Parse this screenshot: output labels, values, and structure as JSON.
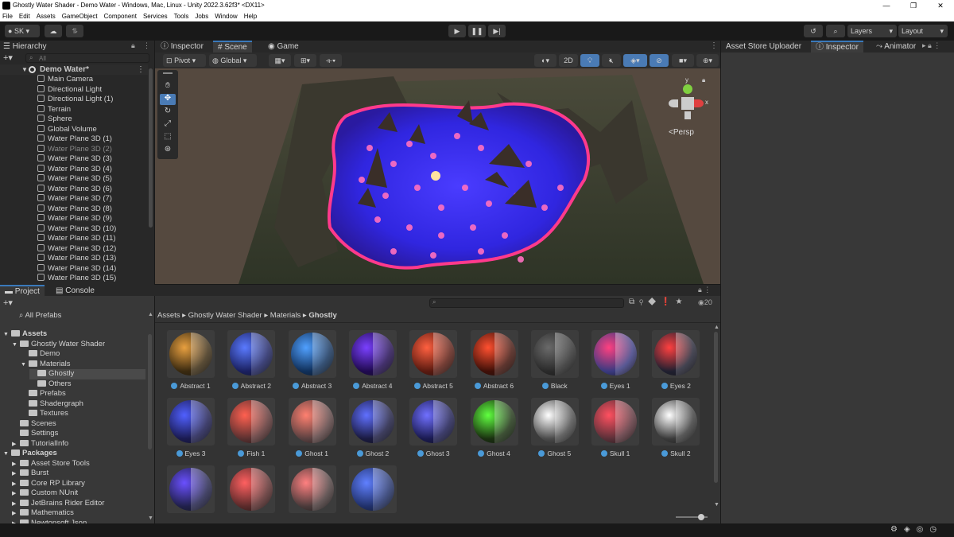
{
  "window": {
    "title": "Ghostly Water Shader - Demo Water - Windows, Mac, Linux - Unity 2022.3.62f3* <DX11>",
    "controls": [
      "—",
      "❐",
      "✕"
    ]
  },
  "menu": [
    "File",
    "Edit",
    "Assets",
    "GameObject",
    "Component",
    "Services",
    "Tools",
    "Jobs",
    "Window",
    "Help"
  ],
  "toolbar": {
    "account": "SK",
    "layers": "Layers",
    "layout": "Layout"
  },
  "hierarchy": {
    "tab": "Hierarchy",
    "search_placeholder": "All",
    "scene": "Demo Water*",
    "items": [
      {
        "label": "Main Camera",
        "dim": false
      },
      {
        "label": "Directional Light",
        "dim": false
      },
      {
        "label": "Directional Light (1)",
        "dim": false
      },
      {
        "label": "Terrain",
        "dim": false
      },
      {
        "label": "Sphere",
        "dim": false
      },
      {
        "label": "Global Volume",
        "dim": false
      },
      {
        "label": "Water Plane 3D (1)",
        "dim": false
      },
      {
        "label": "Water Plane 3D (2)",
        "dim": true
      },
      {
        "label": "Water Plane 3D (3)",
        "dim": false
      },
      {
        "label": "Water Plane 3D (4)",
        "dim": false
      },
      {
        "label": "Water Plane 3D (5)",
        "dim": false
      },
      {
        "label": "Water Plane 3D (6)",
        "dim": false
      },
      {
        "label": "Water Plane 3D (7)",
        "dim": false
      },
      {
        "label": "Water Plane 3D (8)",
        "dim": false
      },
      {
        "label": "Water Plane 3D (9)",
        "dim": false
      },
      {
        "label": "Water Plane 3D (10)",
        "dim": false
      },
      {
        "label": "Water Plane 3D (11)",
        "dim": false
      },
      {
        "label": "Water Plane 3D (12)",
        "dim": false
      },
      {
        "label": "Water Plane 3D (13)",
        "dim": false
      },
      {
        "label": "Water Plane 3D (14)",
        "dim": false
      },
      {
        "label": "Water Plane 3D (15)",
        "dim": false
      }
    ]
  },
  "scene_tabs": {
    "inspector": "Inspector",
    "scene": "Scene",
    "game": "Game"
  },
  "scene_tools": {
    "pivot": "Pivot",
    "global": "Global",
    "mode_2d": "2D",
    "persp": "<Persp",
    "gizmo_y": "y",
    "gizmo_x": "x"
  },
  "right_tabs": {
    "uploader": "Asset Store Uploader",
    "inspector": "Inspector",
    "animator": "Animator"
  },
  "project": {
    "tab": "Project",
    "console_tab": "Console",
    "all_prefabs": "All Prefabs",
    "tree": [
      {
        "label": "Assets",
        "bold": true,
        "arrow": "▼"
      },
      {
        "label": "Ghostly Water Shader",
        "bold": false,
        "arrow": "▼"
      },
      {
        "label": "Demo",
        "bold": false,
        "arrow": ""
      },
      {
        "label": "Materials",
        "bold": false,
        "arrow": "▼"
      },
      {
        "label": "Ghostly",
        "bold": false,
        "arrow": ""
      },
      {
        "label": "Others",
        "bold": false,
        "arrow": ""
      },
      {
        "label": "Prefabs",
        "bold": false,
        "arrow": ""
      },
      {
        "label": "Shadergraph",
        "bold": false,
        "arrow": ""
      },
      {
        "label": "Textures",
        "bold": false,
        "arrow": ""
      },
      {
        "label": "Scenes",
        "bold": false,
        "arrow": ""
      },
      {
        "label": "Settings",
        "bold": false,
        "arrow": ""
      },
      {
        "label": "TutorialInfo",
        "bold": false,
        "arrow": "▶"
      },
      {
        "label": "Packages",
        "bold": true,
        "arrow": "▼"
      },
      {
        "label": "Asset Store Tools",
        "bold": false,
        "arrow": "▶"
      },
      {
        "label": "Burst",
        "bold": false,
        "arrow": "▶"
      },
      {
        "label": "Core RP Library",
        "bold": false,
        "arrow": "▶"
      },
      {
        "label": "Custom NUnit",
        "bold": false,
        "arrow": "▶"
      },
      {
        "label": "JetBrains Rider Editor",
        "bold": false,
        "arrow": "▶"
      },
      {
        "label": "Mathematics",
        "bold": false,
        "arrow": "▶"
      },
      {
        "label": "Newtonsoft Json",
        "bold": false,
        "arrow": "▶"
      }
    ],
    "breadcrumb": [
      "Assets",
      "Ghostly Water Shader",
      "Materials",
      "Ghostly"
    ],
    "hidden_count": "20",
    "materials": [
      {
        "label": "Abstract 1",
        "color": "#e8a040",
        "bg": "#3a2a10"
      },
      {
        "label": "Abstract 2",
        "color": "#5a7aff",
        "bg": "#1a2060"
      },
      {
        "label": "Abstract 3",
        "color": "#50a0ff",
        "bg": "#10305a"
      },
      {
        "label": "Abstract 4",
        "color": "#7a40ff",
        "bg": "#200a50"
      },
      {
        "label": "Abstract 5",
        "color": "#ff6040",
        "bg": "#5a1a10"
      },
      {
        "label": "Abstract 6",
        "color": "#ff5030",
        "bg": "#401008"
      },
      {
        "label": "Black",
        "color": "#6a6a6a",
        "bg": "#2a2a2a"
      },
      {
        "label": "Eyes 1",
        "color": "#ff4080",
        "bg": "#3a3a80"
      },
      {
        "label": "Eyes 2",
        "color": "#ff4040",
        "bg": "#202030"
      },
      {
        "label": "Eyes 3",
        "color": "#5060ff",
        "bg": "#1a1a50"
      },
      {
        "label": "Fish 1",
        "color": "#ff6050",
        "bg": "#5a3030"
      },
      {
        "label": "Ghost 1",
        "color": "#ff8070",
        "bg": "#5a4040"
      },
      {
        "label": "Ghost 2",
        "color": "#6070ff",
        "bg": "#1a1a40"
      },
      {
        "label": "Ghost 3",
        "color": "#7070ff",
        "bg": "#1a1a50"
      },
      {
        "label": "Ghost 4",
        "color": "#60ff40",
        "bg": "#1a3010"
      },
      {
        "label": "Ghost 5",
        "color": "#ffffff",
        "bg": "#4a4a4a"
      },
      {
        "label": "Skull 1",
        "color": "#ff5060",
        "bg": "#5a3038"
      },
      {
        "label": "Skull 2",
        "color": "#ffffff",
        "bg": "#3a3a3a"
      },
      {
        "label": "",
        "color": "#6a50ff",
        "bg": "#20204a"
      },
      {
        "label": "",
        "color": "#ff6060",
        "bg": "#5a2a2a"
      },
      {
        "label": "",
        "color": "#ff8080",
        "bg": "#4a3a3a"
      },
      {
        "label": "",
        "color": "#6080ff",
        "bg": "#20306a"
      }
    ]
  }
}
